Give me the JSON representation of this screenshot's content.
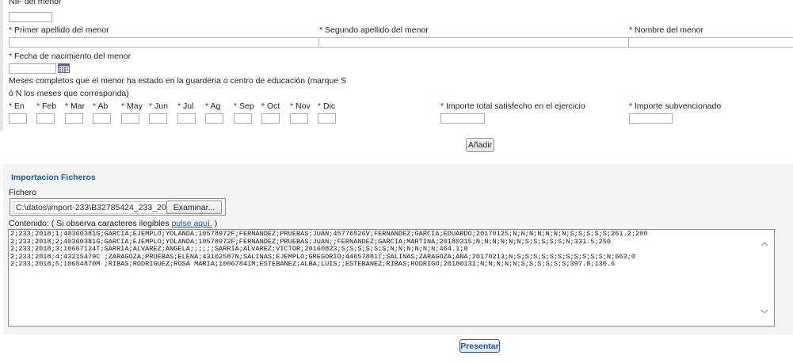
{
  "form": {
    "nif_label": "NIF del menor",
    "primer_apellido_label": "Primer apellido del menor",
    "segundo_apellido_label": "Segundo apellido del menor",
    "nombre_label": "Nombre del menor",
    "fecha_nacimiento_label": "Fecha de nacimiento del menor",
    "meses_line1": "Meses completos que el menor ha estado en la guarderia o centro de educación (marque S",
    "meses_line2": "ó N los meses que corresponda)",
    "months": [
      "En",
      "Feb",
      "Mar",
      "Ab",
      "May",
      "Jun",
      "Jul",
      "Ag",
      "Sep",
      "Oct",
      "Nov",
      "Dic"
    ],
    "importe_total_label": "Importe total satisfecho en el ejercicio",
    "importe_subvencionado_label": "Importe subvencionado",
    "required_mark": "*",
    "add_button": "Añadir"
  },
  "import": {
    "section_title": "Importacion Ficheros",
    "file_label": "Fichero",
    "file_value": "C:\\datos\\import-233\\B32785424_233_2018",
    "browse_button": "Examinar...",
    "content_prefix": "Contenido: ( Si observa caracteres ilegibles ",
    "content_link": "pulse aquí.",
    "content_suffix": " )",
    "content_lines": [
      "2;233;2018;1;40360381G;GARCIA;EJEMPLO;YOLANDA;10578972F;FERNANDEZ;PRUEBAS;JUAN;45776526V;FERNANDEZ;GARCIA;EDUARDO;20170125;N;N;N;N;N;N;N;S;S;S;S;S;261.2;200",
      "2;233;2018;2;40360381G;GARCIA;EJEMPLO;YOLANDA;10578972F;FERNANDEZ;PRUEBAS;JUAN;;FERNANDEZ;GARCIA;MARTINA;20180315;N;N;N;N;N;N;S;S;S;S;S;N;331.5;250",
      "2;233;2018;3;10667124T;SARRIA;ALVAREZ;ANGELA;;;;;;SARRIA;ALVAREZ;VICTOR;20160823;S;S;S;S;S;S;N;N;N;N;N;N;464.1;0",
      "2;233;2018;4;43215479C ;ZARAGOZA;PRUEBAS;ELENA;43102587N;SALINAS;EJEMPLO;GREGORIO;44657881T;SALINAS;ZARAGOZA;ANA;20170213;N;S;S;S;S;S;S;S;S;S;S;S;N;663;0",
      "2;233;2018;5;10654870M ;RIBAS;RODRIGUEZ;ROSA MARIA;10067841M;ESTEBANEZ;ALBA;LUIS;;ESTEBANEZ;RIBAS;RODRIGO;20180131;N;N;N;N;N;S;S;S;S;S;S;397.8;130.6"
    ]
  },
  "submit_button": "Presentar",
  "icons": {
    "calendar": "calendar-icon",
    "scroll_up": "chevron-up-icon",
    "scroll_down": "chevron-down-icon"
  }
}
